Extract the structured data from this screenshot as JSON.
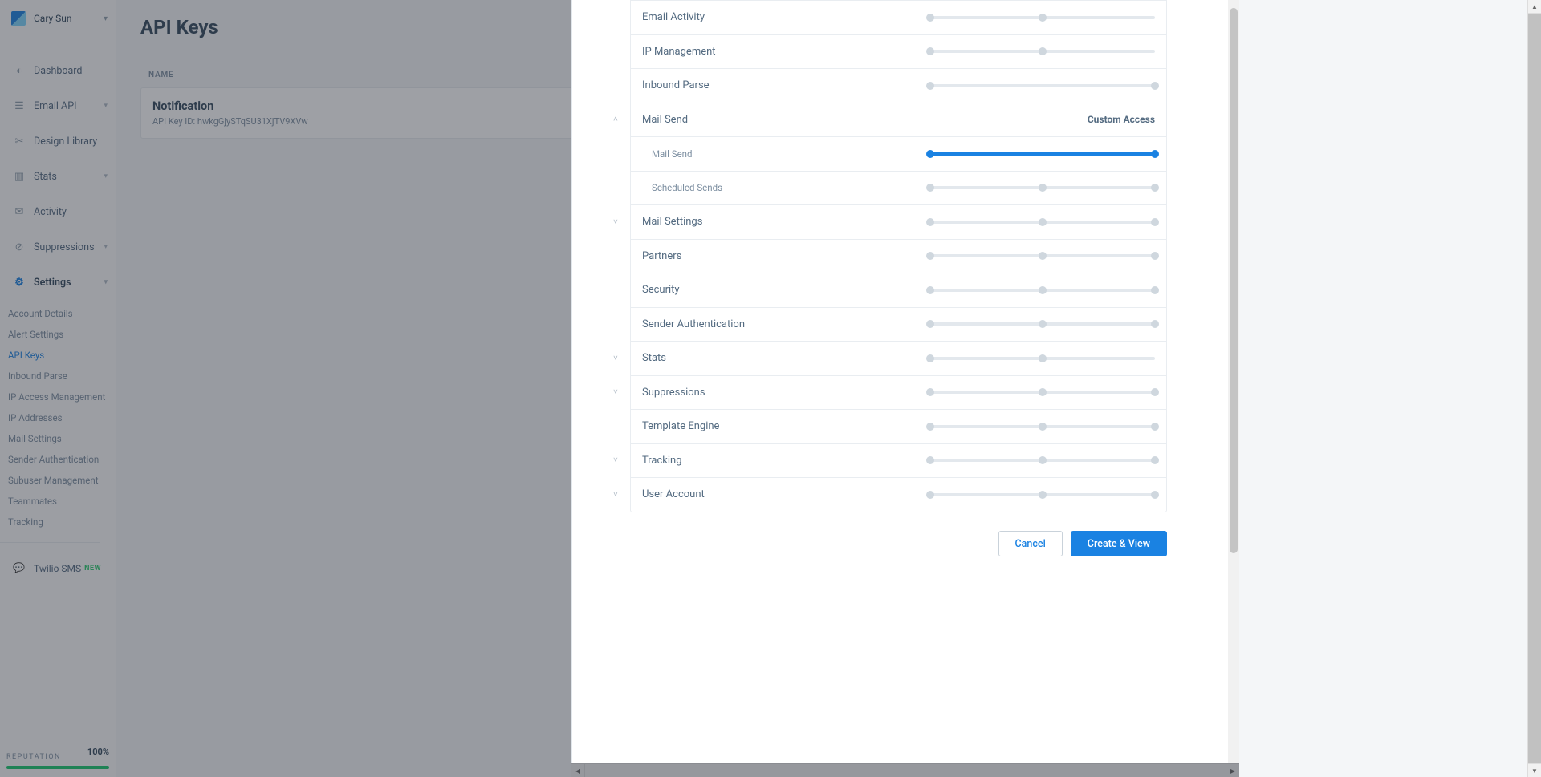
{
  "account": {
    "name": "Cary Sun"
  },
  "nav": {
    "dashboard": "Dashboard",
    "email_api": "Email API",
    "design_library": "Design Library",
    "stats": "Stats",
    "activity": "Activity",
    "suppressions": "Suppressions",
    "settings": "Settings",
    "twilio": "Twilio SMS",
    "twilio_badge": "NEW"
  },
  "settings_sub": {
    "account_details": "Account Details",
    "alert_settings": "Alert Settings",
    "api_keys": "API Keys",
    "inbound_parse": "Inbound Parse",
    "ip_access": "IP Access Management",
    "ip_addresses": "IP Addresses",
    "mail_settings": "Mail Settings",
    "sender_auth": "Sender Authentication",
    "subuser": "Subuser Management",
    "teammates": "Teammates",
    "tracking": "Tracking"
  },
  "reputation": {
    "label": "REPUTATION",
    "percent": "100%"
  },
  "page": {
    "title": "API Keys",
    "col_name": "NAME"
  },
  "api_row": {
    "title": "Notification",
    "id_label": "API Key ID: hwkgGjySTqSU31XjTV9XVw"
  },
  "modal": {
    "custom_access": "Custom Access",
    "rows": {
      "email_activity": "Email Activity",
      "ip_management": "IP Management",
      "inbound_parse": "Inbound Parse",
      "mail_send": "Mail Send",
      "mail_send_sub": "Mail Send",
      "scheduled_sends": "Scheduled Sends",
      "mail_settings": "Mail Settings",
      "partners": "Partners",
      "security": "Security",
      "sender_auth": "Sender Authentication",
      "stats": "Stats",
      "suppressions": "Suppressions",
      "template_engine": "Template Engine",
      "tracking": "Tracking",
      "user_account": "User Account"
    },
    "cancel": "Cancel",
    "create": "Create & View"
  }
}
